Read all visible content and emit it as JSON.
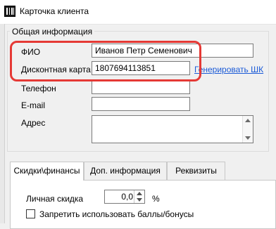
{
  "window": {
    "title": "Карточка клиента",
    "icon": "barcode-app-icon"
  },
  "general_group": {
    "title": "Общая информация",
    "fields": {
      "fio_label": "ФИО",
      "fio_value": "Иванов Петр Семенович",
      "card_label": "Дисконтная карта",
      "card_value": "1807694113851",
      "generate_link": "Генерировать ШК",
      "phone_label": "Телефон",
      "phone_value": "",
      "email_label": "E-mail",
      "email_value": "",
      "address_label": "Адрес",
      "address_value": ""
    },
    "highlight_color": "#e53935"
  },
  "tabs": [
    {
      "label": "Скидки\\финансы",
      "active": true
    },
    {
      "label": "Доп. информация",
      "active": false
    },
    {
      "label": "Реквизиты",
      "active": false
    }
  ],
  "finance": {
    "discount_label": "Личная скидка",
    "discount_value": "0,0",
    "percent_unit": "%",
    "bonus_checkbox_label": "Запретить использовать баллы/бонусы",
    "bonus_checkbox_checked": false
  },
  "colors": {
    "link": "#1a5ad7",
    "window_bg": "#f0f0f0"
  }
}
